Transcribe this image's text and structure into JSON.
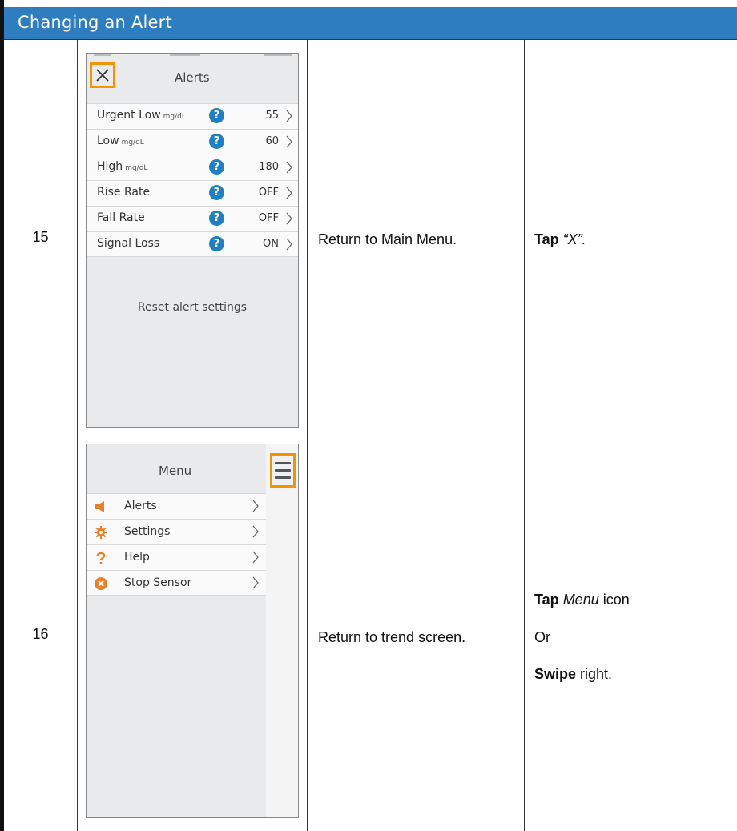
{
  "header": {
    "title": "Changing an Alert"
  },
  "steps": [
    {
      "number": "15",
      "action": "Return to Main Menu.",
      "instruction": {
        "verb": "Tap",
        "object": "“X”."
      },
      "screen": {
        "title": "Alerts",
        "close_icon": "close-icon",
        "rows": [
          {
            "label": "Urgent Low",
            "unit": "mg/dL",
            "value": "55"
          },
          {
            "label": "Low",
            "unit": "mg/dL",
            "value": "60"
          },
          {
            "label": "High",
            "unit": "mg/dL",
            "value": "180"
          },
          {
            "label": "Rise Rate",
            "unit": "",
            "value": "OFF"
          },
          {
            "label": "Fall Rate",
            "unit": "",
            "value": "OFF"
          },
          {
            "label": "Signal Loss",
            "unit": "",
            "value": "ON"
          }
        ],
        "help_glyph": "?",
        "reset_label": "Reset alert settings"
      }
    },
    {
      "number": "16",
      "action": "Return to trend screen.",
      "instruction": {
        "verb": "Tap",
        "object": "Menu",
        "suffix": "icon",
        "or": "Or",
        "verb2": "Swipe",
        "suffix2": "right."
      },
      "screen": {
        "title": "Menu",
        "menu_icon": "hamburger-menu-icon",
        "items": [
          {
            "label": "Alerts",
            "icon": "speaker-icon"
          },
          {
            "label": "Settings",
            "icon": "gear-icon"
          },
          {
            "label": "Help",
            "icon": "question-mark-icon"
          },
          {
            "label": "Stop Sensor",
            "icon": "stop-sensor-icon"
          }
        ]
      }
    }
  ],
  "colors": {
    "header_bg": "#2e7dbf",
    "highlight": "#f29400",
    "help_icon": "#1f7fc4",
    "menu_icon": "#e8822a"
  }
}
